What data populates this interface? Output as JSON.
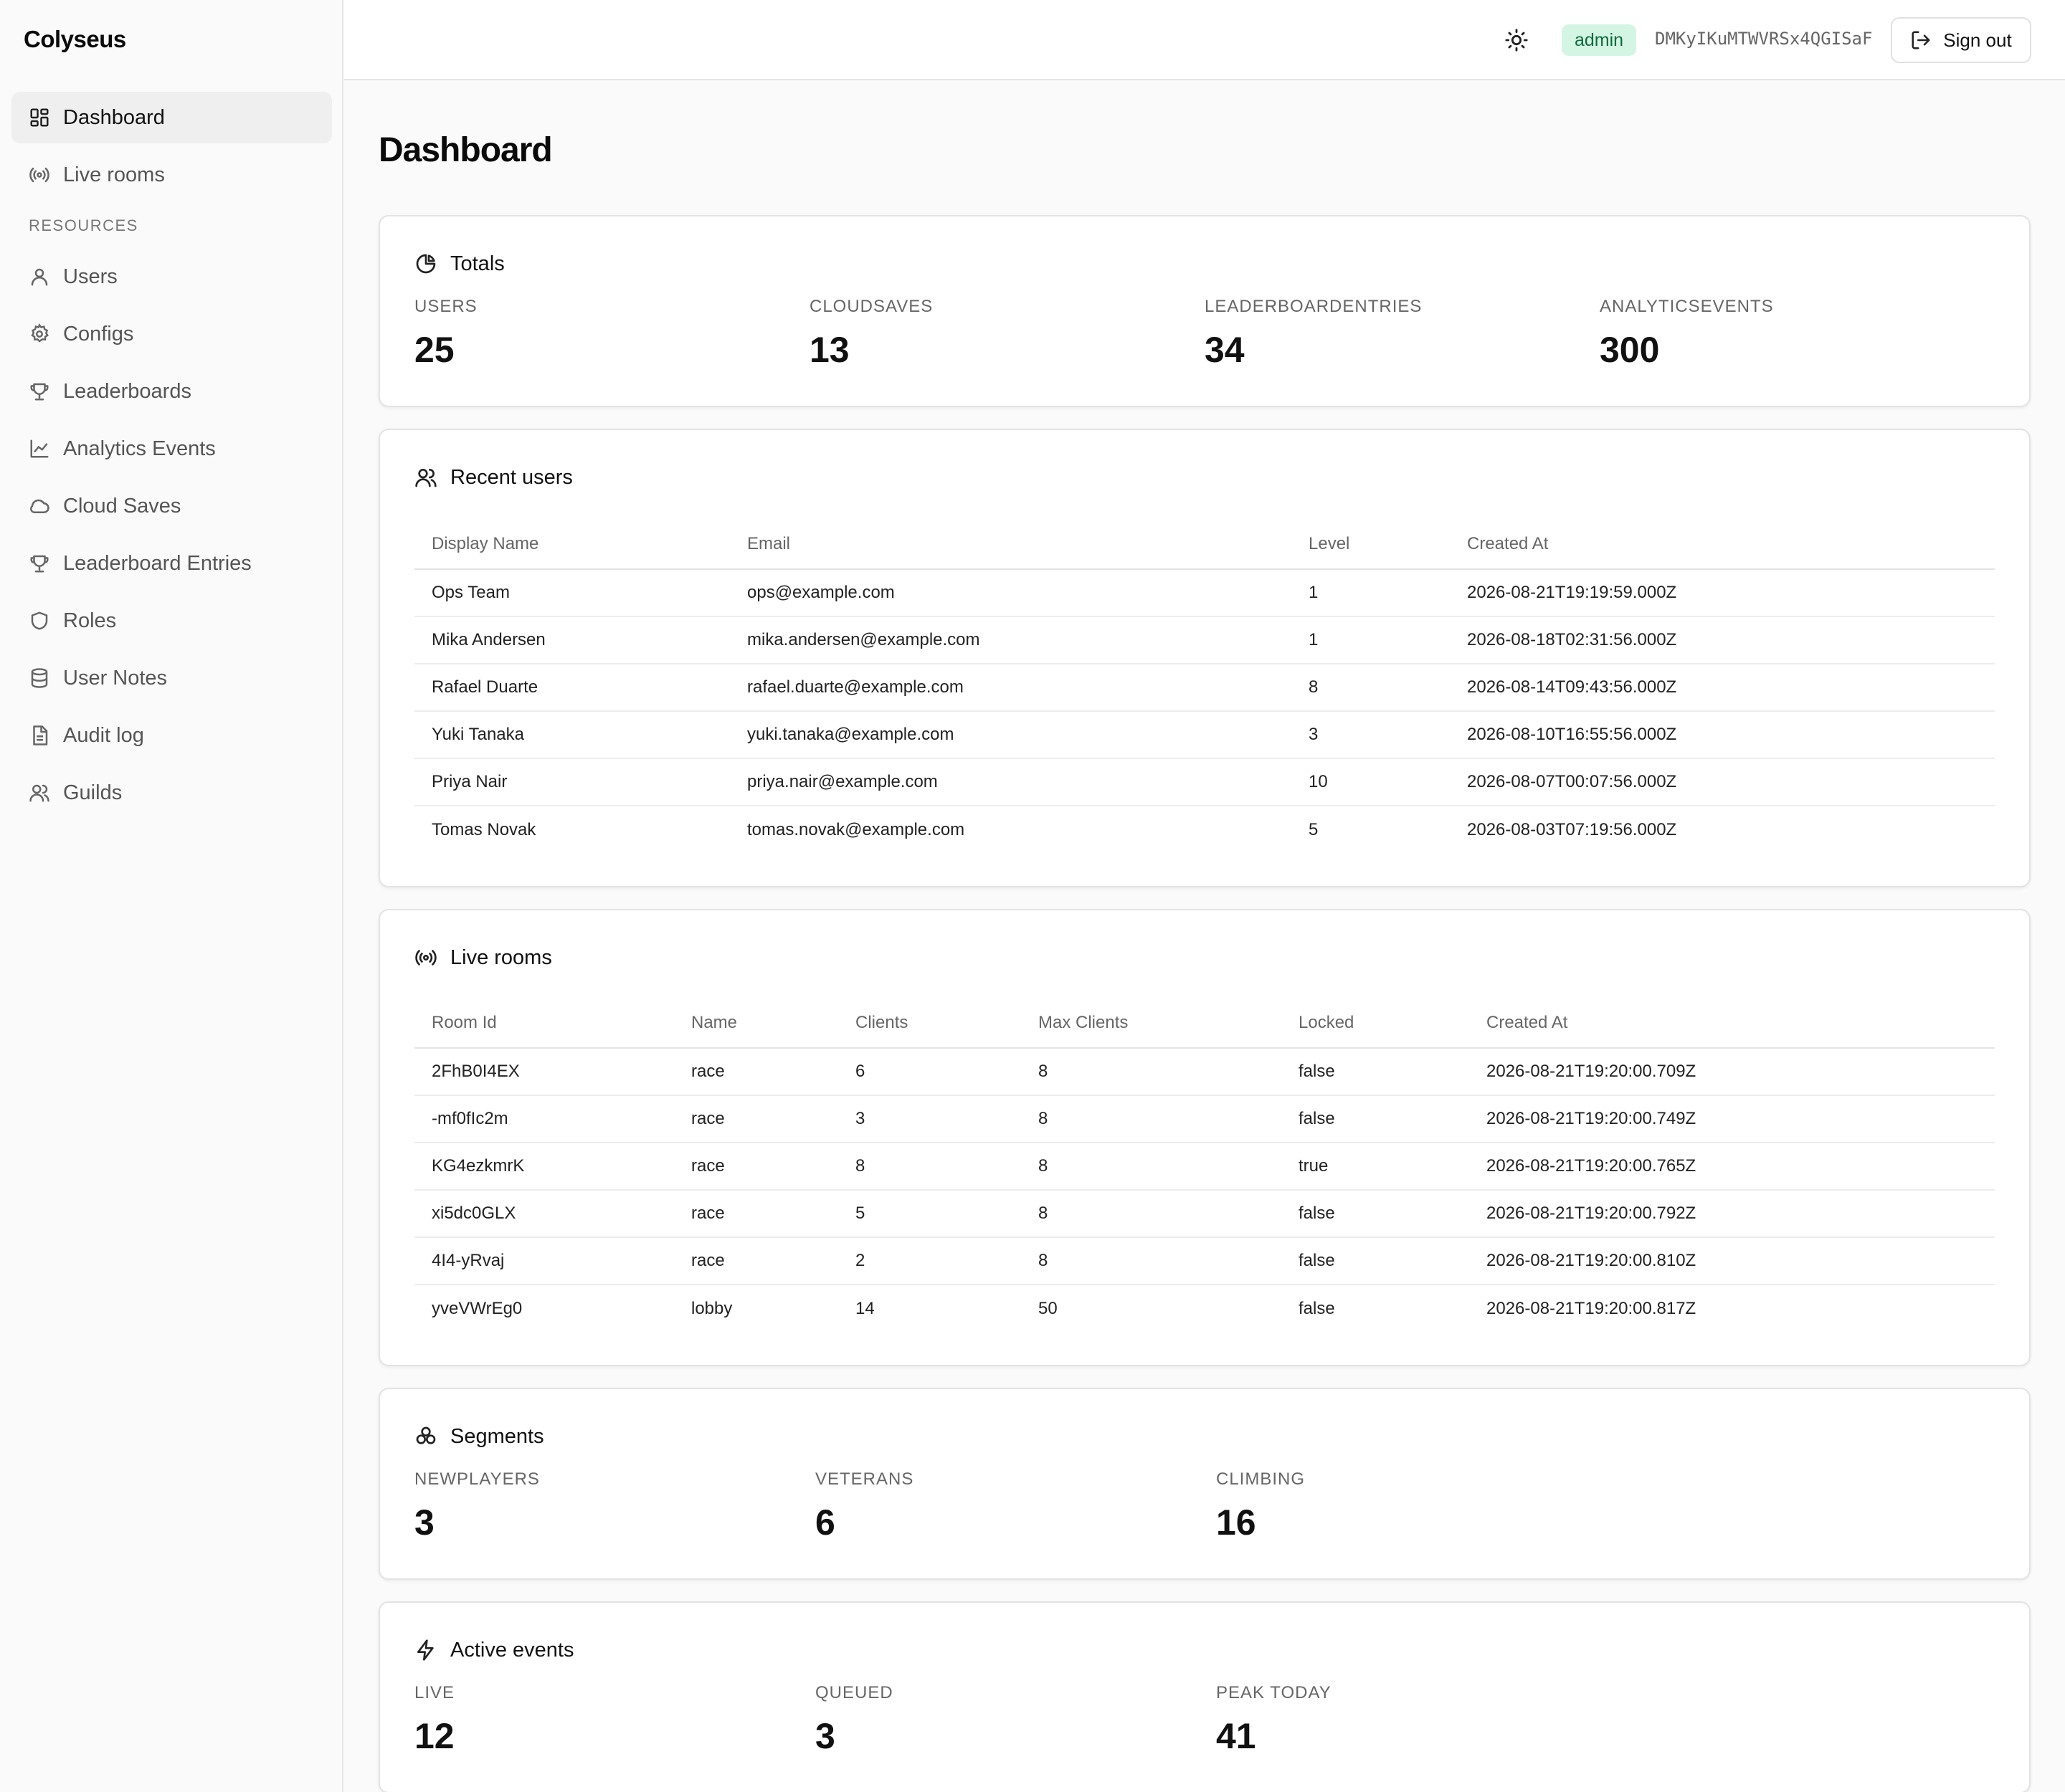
{
  "app": {
    "brand": "Colyseus"
  },
  "sidebar": {
    "items": [
      {
        "label": "Dashboard",
        "icon": "dashboard-icon",
        "active": true
      },
      {
        "label": "Live rooms",
        "icon": "broadcast-icon"
      }
    ],
    "section_label": "RESOURCES",
    "resources": [
      {
        "label": "Users",
        "icon": "user-icon"
      },
      {
        "label": "Configs",
        "icon": "gear-icon"
      },
      {
        "label": "Leaderboards",
        "icon": "trophy-icon"
      },
      {
        "label": "Analytics Events",
        "icon": "line-chart-icon"
      },
      {
        "label": "Cloud Saves",
        "icon": "cloud-icon"
      },
      {
        "label": "Leaderboard Entries",
        "icon": "trophy-icon"
      },
      {
        "label": "Roles",
        "icon": "shield-icon"
      },
      {
        "label": "User Notes",
        "icon": "database-icon"
      },
      {
        "label": "Audit log",
        "icon": "file-text-icon"
      },
      {
        "label": "Guilds",
        "icon": "users-icon"
      }
    ]
  },
  "topbar": {
    "role": "admin",
    "token": "DMKyIKuMTWVRSx4QGISaF",
    "signout_label": "Sign out",
    "role_color": "#d4f5e4"
  },
  "main": {
    "title": "Dashboard",
    "totals": {
      "title": "Totals",
      "stats": [
        {
          "label": "USERS",
          "value": "25"
        },
        {
          "label": "CLOUDSAVES",
          "value": "13"
        },
        {
          "label": "LEADERBOARDENTRIES",
          "value": "34"
        },
        {
          "label": "ANALYTICSEVENTS",
          "value": "300"
        }
      ]
    },
    "recent_users": {
      "title": "Recent users",
      "columns": [
        "Display Name",
        "Email",
        "Level",
        "Created At"
      ],
      "rows": [
        [
          "Ops Team",
          "ops@example.com",
          "1",
          "2026-08-21T19:19:59.000Z"
        ],
        [
          "Mika Andersen",
          "mika.andersen@example.com",
          "1",
          "2026-08-18T02:31:56.000Z"
        ],
        [
          "Rafael Duarte",
          "rafael.duarte@example.com",
          "8",
          "2026-08-14T09:43:56.000Z"
        ],
        [
          "Yuki Tanaka",
          "yuki.tanaka@example.com",
          "3",
          "2026-08-10T16:55:56.000Z"
        ],
        [
          "Priya Nair",
          "priya.nair@example.com",
          "10",
          "2026-08-07T00:07:56.000Z"
        ],
        [
          "Tomas Novak",
          "tomas.novak@example.com",
          "5",
          "2026-08-03T07:19:56.000Z"
        ]
      ]
    },
    "live_rooms": {
      "title": "Live rooms",
      "columns": [
        "Room Id",
        "Name",
        "Clients",
        "Max Clients",
        "Locked",
        "Created At"
      ],
      "rows": [
        [
          "2FhB0I4EX",
          "race",
          "6",
          "8",
          "false",
          "2026-08-21T19:20:00.709Z"
        ],
        [
          "-mf0fIc2m",
          "race",
          "3",
          "8",
          "false",
          "2026-08-21T19:20:00.749Z"
        ],
        [
          "KG4ezkmrK",
          "race",
          "8",
          "8",
          "true",
          "2026-08-21T19:20:00.765Z"
        ],
        [
          "xi5dc0GLX",
          "race",
          "5",
          "8",
          "false",
          "2026-08-21T19:20:00.792Z"
        ],
        [
          "4I4-yRvaj",
          "race",
          "2",
          "8",
          "false",
          "2026-08-21T19:20:00.810Z"
        ],
        [
          "yveVWrEg0",
          "lobby",
          "14",
          "50",
          "false",
          "2026-08-21T19:20:00.817Z"
        ]
      ]
    },
    "segments": {
      "title": "Segments",
      "stats": [
        {
          "label": "NEWPLAYERS",
          "value": "3"
        },
        {
          "label": "VETERANS",
          "value": "6"
        },
        {
          "label": "CLIMBING",
          "value": "16"
        }
      ]
    },
    "active_events": {
      "title": "Active events",
      "stats": [
        {
          "label": "LIVE",
          "value": "12"
        },
        {
          "label": "QUEUED",
          "value": "3"
        },
        {
          "label": "PEAK TODAY",
          "value": "41"
        }
      ]
    }
  }
}
